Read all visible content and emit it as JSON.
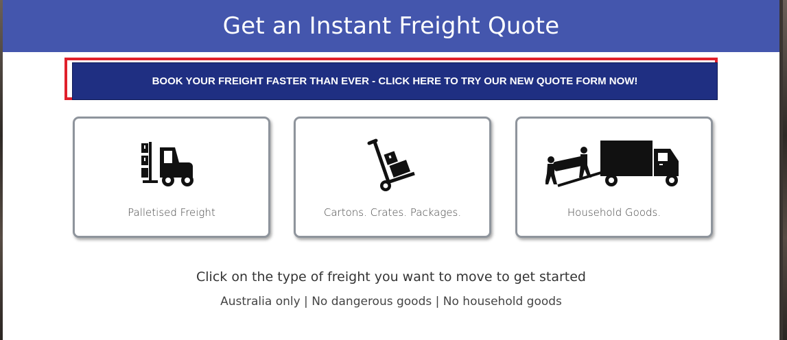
{
  "header": {
    "title": "Get an Instant Freight Quote"
  },
  "promo": {
    "label": "BOOK YOUR FREIGHT FASTER THAN EVER - CLICK HERE TO TRY OUR NEW QUOTE FORM NOW!"
  },
  "options": [
    {
      "label": "Palletised Freight",
      "icon": "forklift-icon"
    },
    {
      "label": "Cartons. Crates. Packages.",
      "icon": "hand-truck-icon"
    },
    {
      "label": "Household Goods.",
      "icon": "moving-truck-icon"
    }
  ],
  "instructions": "Click on the type of freight you want to move to get started",
  "restrictions": "Australia only | No dangerous goods | No household goods",
  "colors": {
    "header_bg": "#4456ad",
    "promo_bg": "#1f2f82",
    "highlight": "#e0202b"
  }
}
